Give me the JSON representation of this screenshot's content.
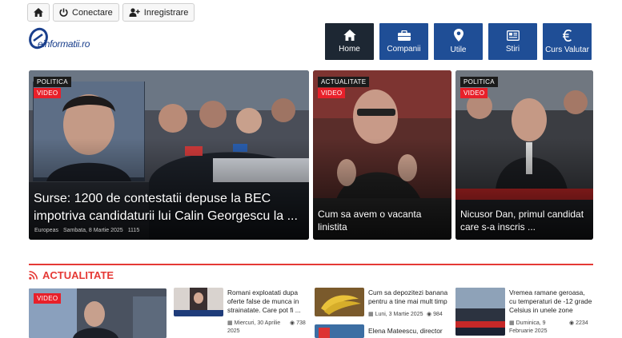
{
  "topbar": {
    "connect_label": "Conectare",
    "register_label": "Inregistrare"
  },
  "logo": {
    "text": "einformatii.ro"
  },
  "nav": [
    {
      "label": "Home",
      "icon": "home-icon",
      "active": true
    },
    {
      "label": "Companii",
      "icon": "briefcase-icon"
    },
    {
      "label": "Utile",
      "icon": "map-marker-icon"
    },
    {
      "label": "Stiri",
      "icon": "newspaper-icon"
    },
    {
      "label": "Curs Valutar",
      "icon": "euro-icon"
    }
  ],
  "hero": [
    {
      "category": "POLITICA",
      "badge": "VIDEO",
      "title": "Surse: 1200 de contestatii depuse la BEC impotriva candidaturii lui Calin Georgescu la ...",
      "source": "Europeas",
      "date": "Sambata, 8 Martie 2025",
      "views": "1115"
    },
    {
      "category": "ACTUALITATE",
      "badge": "VIDEO",
      "title": "Cum sa avem o vacanta linistita"
    },
    {
      "category": "POLITICA",
      "badge": "VIDEO",
      "title": "Nicusor Dan, primul candidat care s-a inscris ..."
    }
  ],
  "section": {
    "title": "ACTUALITATE"
  },
  "bottom_featured": {
    "badge": "VIDEO"
  },
  "news": [
    {
      "title": "Romani exploatati dupa oferte false de munca in strainatate. Care pot fi ...",
      "date_line1": "Miercuri, 30 Aprilie",
      "date_line2": "2025",
      "views": "738"
    },
    {
      "title": "Cum sa depozitezi banana pentru a tine mai mult timp",
      "date_line1": "Luni, 3 Martie 2025",
      "views": "984"
    },
    {
      "title": "Elena Mateescu, director"
    },
    {
      "title": "Vremea ramane geroasa, cu temperaturi de -12 grade Celsius in unele zone",
      "date_line1": "Duminica, 9",
      "date_line2": "Februarie 2025",
      "views": "2234"
    }
  ],
  "colors": {
    "nav_blue": "#1f4e96",
    "nav_active": "#1d2733",
    "accent_red": "#e53935",
    "video_red": "#e8202a"
  }
}
